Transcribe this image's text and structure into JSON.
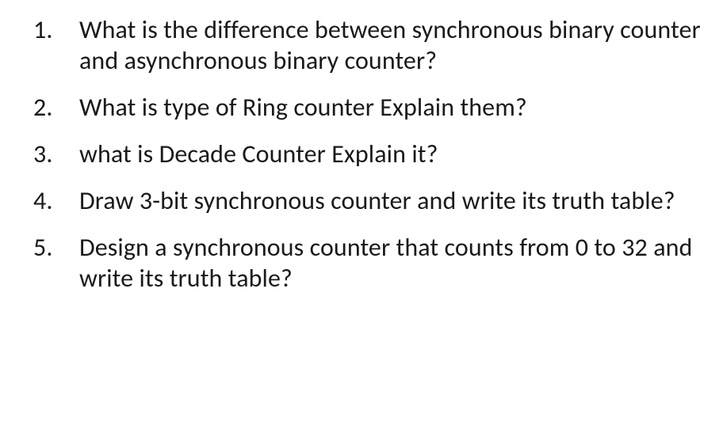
{
  "questions": [
    {
      "text": "What is the difference between synchronous binary counter and asynchronous binary counter?"
    },
    {
      "text": "What is type of Ring counter Explain them?"
    },
    {
      "text": " what is  Decade Counter Explain it?"
    },
    {
      "text": "Draw 3-bit synchronous counter and write its truth table?"
    },
    {
      "text": "Design a synchronous counter that counts from 0 to 32 and write its truth table?"
    }
  ]
}
